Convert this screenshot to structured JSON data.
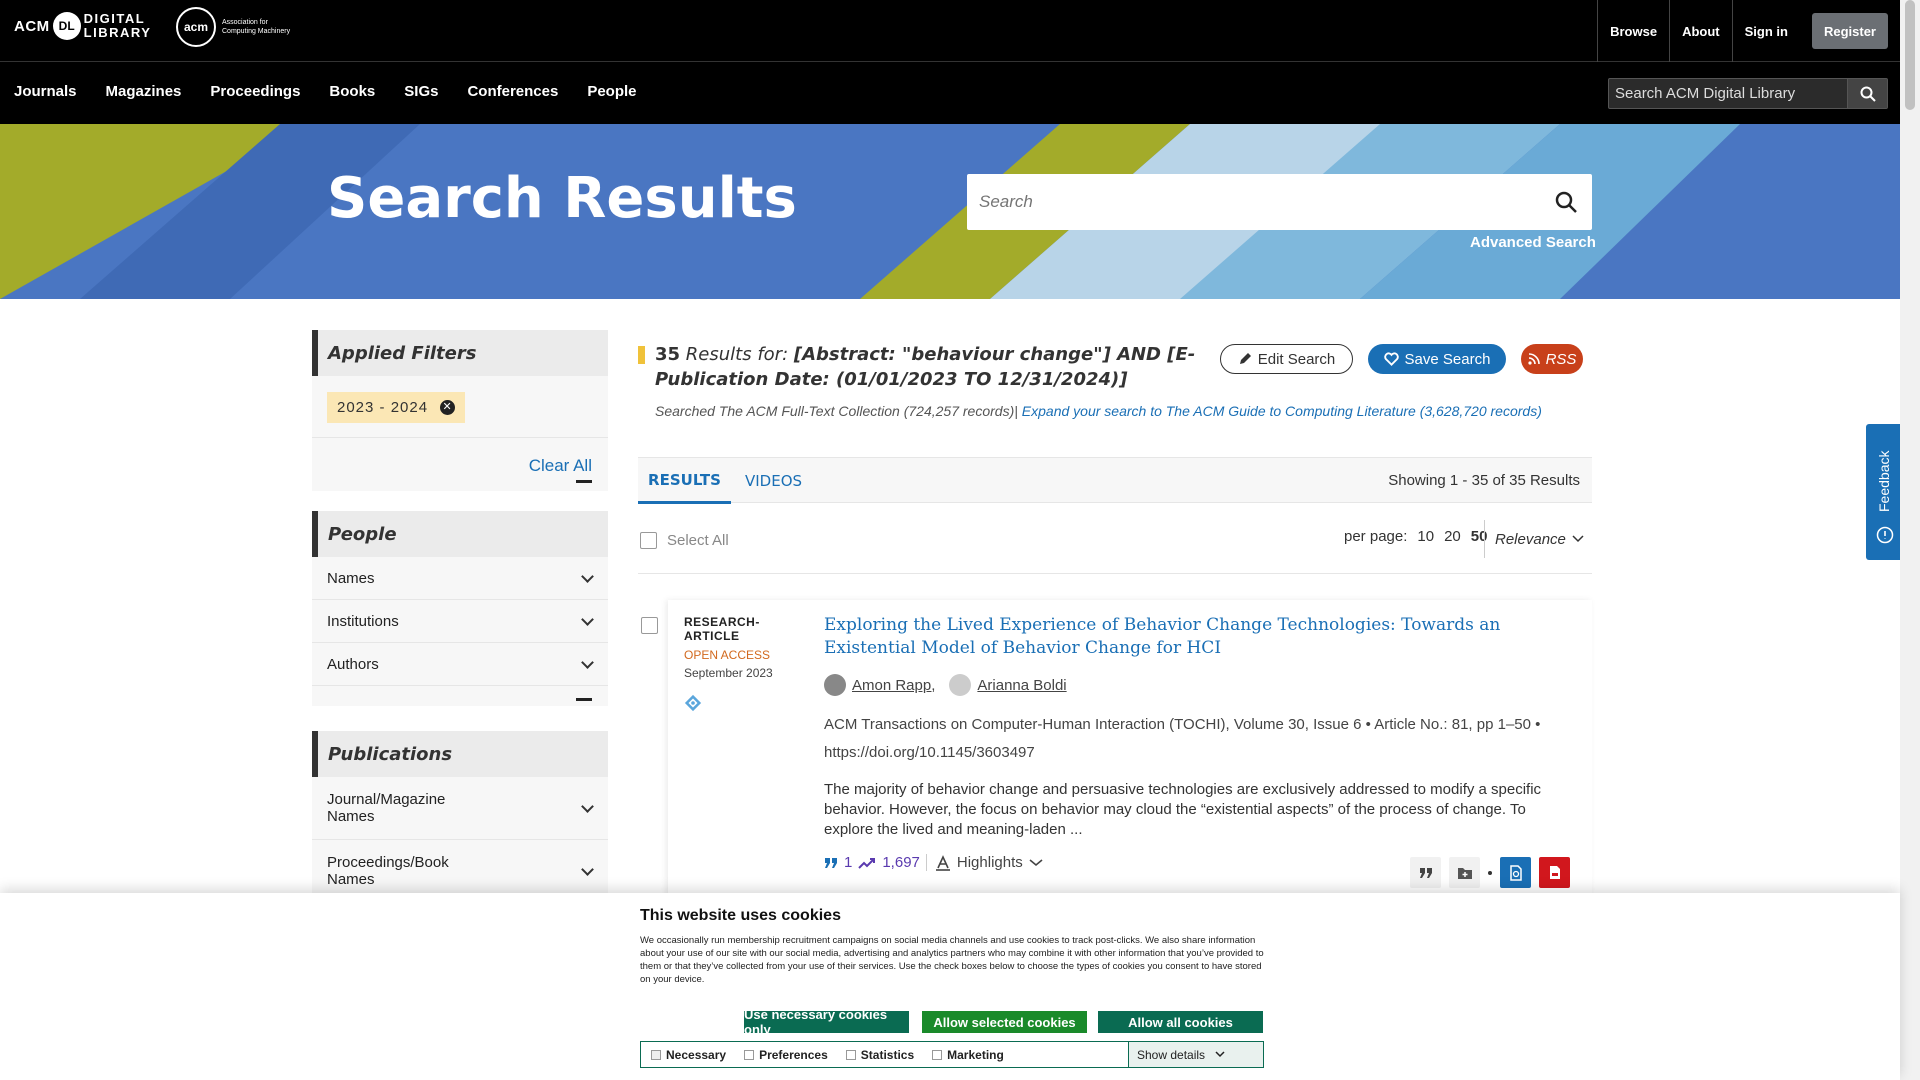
{
  "header": {
    "logo_dl_acm": "ACM",
    "logo_dl_badge": "DL",
    "logo_dl_line1": "DIGITAL",
    "logo_dl_line2": "LIBRARY",
    "logo_acm_circle": "acm",
    "logo_acm_line1": "Association for",
    "logo_acm_line2": "Computing Machinery",
    "links": {
      "browse": "Browse",
      "about": "About",
      "signin": "Sign in",
      "register": "Register"
    }
  },
  "nav": {
    "items": [
      "Journals",
      "Magazines",
      "Proceedings",
      "Books",
      "SIGs",
      "Conferences",
      "People"
    ],
    "search_placeholder": "Search ACM Digital Library"
  },
  "banner": {
    "title": "Search Results",
    "search_placeholder": "Search",
    "advanced": "Advanced Search"
  },
  "sidebar": {
    "applied_filters": {
      "heading": "Applied Filters",
      "chip": "2023 - 2024",
      "clear_all": "Clear All"
    },
    "people": {
      "heading": "People",
      "items": [
        "Names",
        "Institutions",
        "Authors"
      ]
    },
    "publications": {
      "heading": "Publications",
      "items": [
        "Journal/Magazine Names",
        "Proceedings/Book Names"
      ]
    }
  },
  "results_header": {
    "count": "35",
    "results_for": "Results for:",
    "query": "[Abstract: \"behaviour change\"] AND [E-Publication Date: (01/01/2023 TO 12/31/2024)]",
    "edit_search": "Edit Search",
    "save_search": "Save Search",
    "rss": "RSS",
    "searched_in": "Searched The ACM Full-Text Collection (724,257 records)",
    "separator": "|",
    "expand_link": "Expand your search to The ACM Guide to Computing Literature (3,628,720 records)"
  },
  "tabs": {
    "results": "RESULTS",
    "videos": "VIDEOS",
    "showing": "Showing 1 - 35  of 35 Results"
  },
  "controls": {
    "select_all": "Select All",
    "per_page_label": "per page:",
    "per_page_options": [
      "10",
      "20",
      "50"
    ],
    "per_page_selected": "50",
    "sort": "Relevance"
  },
  "result": {
    "type": "RESEARCH-ARTICLE",
    "access": "OPEN ACCESS",
    "date": "September 2023",
    "title": "Exploring the Lived Experience of Behavior Change Technologies: Towards an Existential Model of Behavior Change for HCI",
    "authors": [
      "Amon Rapp,",
      "Arianna Boldi"
    ],
    "publication": "ACM Transactions on Computer-Human Interaction (TOCHI), Volume 30, Issue 6",
    "article_info": "Article No.: 81, pp 1–50",
    "doi": "https://doi.org/10.1145/3603497",
    "abstract": "The majority of behavior change and persuasive technologies are exclusively addressed to modify a specific behavior. However, the focus on behavior may cloud the “existential aspects” of the process of change. To explore the lived and meaning-laden ...",
    "citations": "1",
    "downloads": "1,697",
    "highlights": "Highlights"
  },
  "feedback": {
    "label": "Feedback"
  },
  "cookie": {
    "title": "This website uses cookies",
    "text": "We occasionally run membership recruitment campaigns on social media channels and use cookies to track post-clicks. We also share information about your use of our site with our social media, advertising and analytics partners who may combine it with other information that you’ve provided to them or that they’ve collected from your use of their services. Use the check boxes below to choose the types of cookies you consent to have stored on your device.",
    "btn_necessary": "Use necessary cookies only",
    "btn_selected": "Allow selected cookies",
    "btn_all": "Allow all cookies",
    "opt_necessary": "Necessary",
    "opt_preferences": "Preferences",
    "opt_statistics": "Statistics",
    "opt_marketing": "Marketing",
    "show_details": "Show details"
  },
  "colors": {
    "accent_blue": "#1a6fb5",
    "rss_orange": "#c8401a",
    "open_access": "#d2691e",
    "cookie_green": "#0a6b52"
  }
}
